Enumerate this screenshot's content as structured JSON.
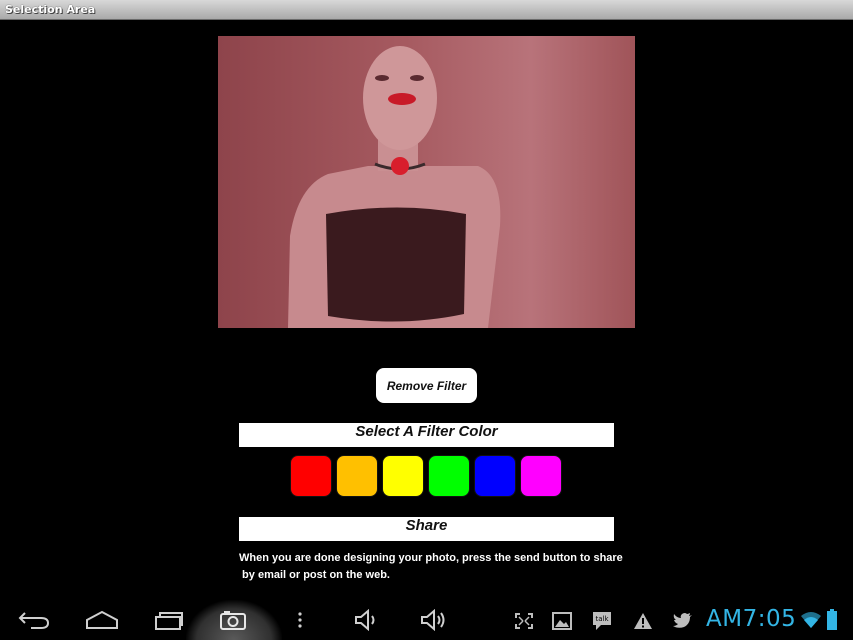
{
  "window": {
    "title": "Selection Area"
  },
  "photo": {
    "shirt_color": "#3a1a1e",
    "face_color": "#c98f92",
    "lip_color": "#c81a28"
  },
  "controls": {
    "remove_filter_label": "Remove Filter"
  },
  "filter_section": {
    "header": "Select A Filter Color",
    "colors": [
      {
        "name": "red",
        "hex": "#ff0000"
      },
      {
        "name": "orange",
        "hex": "#ffc000"
      },
      {
        "name": "yellow",
        "hex": "#ffff00"
      },
      {
        "name": "green",
        "hex": "#00ff00"
      },
      {
        "name": "blue",
        "hex": "#0000ff"
      },
      {
        "name": "magenta",
        "hex": "#ff00ff"
      }
    ]
  },
  "share_section": {
    "header": "Share",
    "line1": "When you are done designing your photo, press the send button to share",
    "line2": " by email or post on the web."
  },
  "nav_bar": {
    "icons": [
      "back-icon",
      "home-icon",
      "recent-apps-icon",
      "camera-icon",
      "menu-icon",
      "volume-down-icon",
      "volume-up-icon"
    ],
    "status_icons": [
      "fullscreen-icon",
      "gallery-icon",
      "talk-icon",
      "warning-icon",
      "twitter-icon",
      "wifi-icon",
      "battery-icon"
    ],
    "talk_label": "talk",
    "clock": "AM7:05",
    "accent": "#33b5e5"
  }
}
